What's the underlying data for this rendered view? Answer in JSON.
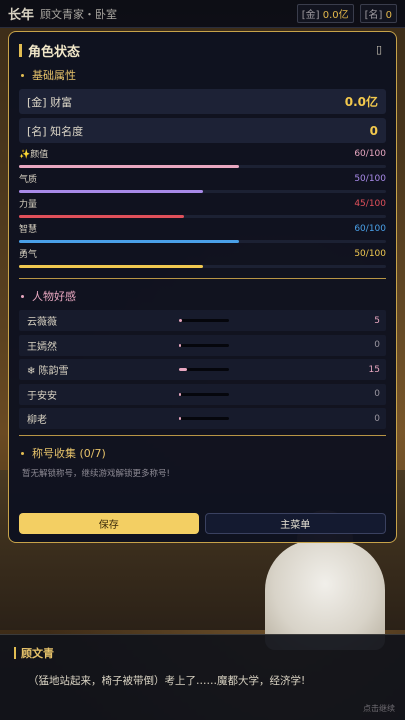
{
  "hud": {
    "logo": "长年",
    "location": "顾文青家・卧室",
    "money_tag": "[金]",
    "money_value": "0.0亿",
    "fame_tag": "[名]",
    "fame_value": "0"
  },
  "panel": {
    "title": "角色状态",
    "close_icon": "▯",
    "basic_title": "基础属性",
    "wealth_label": "[金] 财富",
    "wealth_value": "0.0亿",
    "fame_label": "[名] 知名度",
    "fame_value": "0",
    "attributes": [
      {
        "name": "✨颜值",
        "value": "60/100",
        "ratio": 0.6,
        "color": "#e8a7c0"
      },
      {
        "name": "气质",
        "value": "50/100",
        "ratio": 0.5,
        "color": "#a88ae8"
      },
      {
        "name": "力量",
        "value": "45/100",
        "ratio": 0.45,
        "color": "#e0505a"
      },
      {
        "name": "智慧",
        "value": "60/100",
        "ratio": 0.6,
        "color": "#4aa0e8"
      },
      {
        "name": "勇气",
        "value": "50/100",
        "ratio": 0.5,
        "color": "#f0c850"
      }
    ],
    "relations_title": "人物好感",
    "npcs": [
      {
        "name": "云薇薇",
        "value": "5",
        "ratio": 0.05
      },
      {
        "name": "王嫣然",
        "value": "0",
        "ratio": 0.0
      },
      {
        "name": "❄ 陈韵雪",
        "value": "15",
        "ratio": 0.15
      },
      {
        "name": "于安安",
        "value": "0",
        "ratio": 0.0
      },
      {
        "name": "柳老",
        "value": "0",
        "ratio": 0.0
      }
    ],
    "titles_title": "称号收集 (0/7)",
    "titles_hint": "暂无解锁称号，继续游戏解锁更多称号!",
    "save_label": "保存",
    "menu_label": "主菜单"
  },
  "dialog": {
    "speaker": "顾文青",
    "text": "（猛地站起来，椅子被带倒）考上了……魔都大学，经济学!",
    "continue_hint": "点击继续"
  }
}
